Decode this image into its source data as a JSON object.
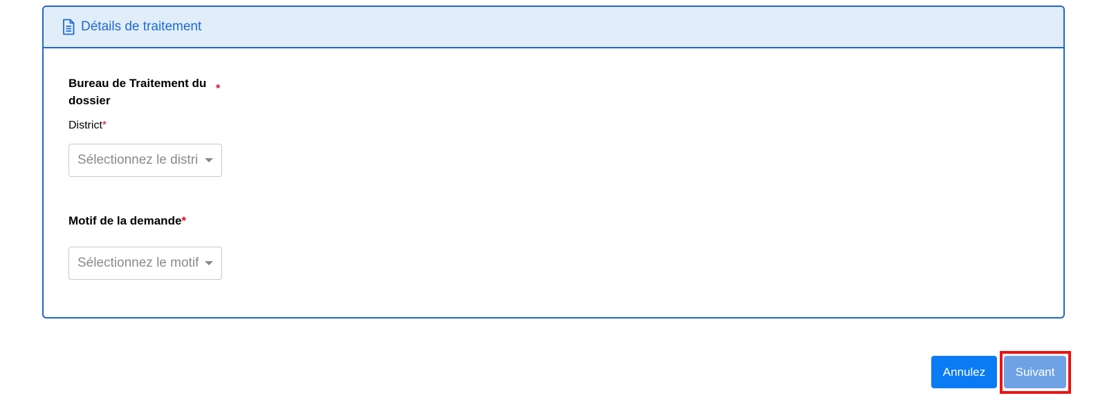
{
  "card": {
    "title": "Détails de traitement",
    "icon": "document-icon"
  },
  "bureau": {
    "title": "Bureau de Traitement du dossier",
    "required_mark": "*"
  },
  "district": {
    "label": "District",
    "required_mark": "*",
    "placeholder": "Sélectionnez le distri"
  },
  "motif": {
    "label": "Motif de la demande",
    "required_mark": "*",
    "placeholder": "Sélectionnez le motif"
  },
  "actions": {
    "cancel_label": "Annulez",
    "next_label": "Suivant"
  },
  "colors": {
    "primary": "#0b7bf4",
    "header_bg": "#e1edf9",
    "border": "#1f66c9",
    "required": "#e8002a",
    "highlight": "#ee1111",
    "next_disabled": "#6ea2e4"
  }
}
